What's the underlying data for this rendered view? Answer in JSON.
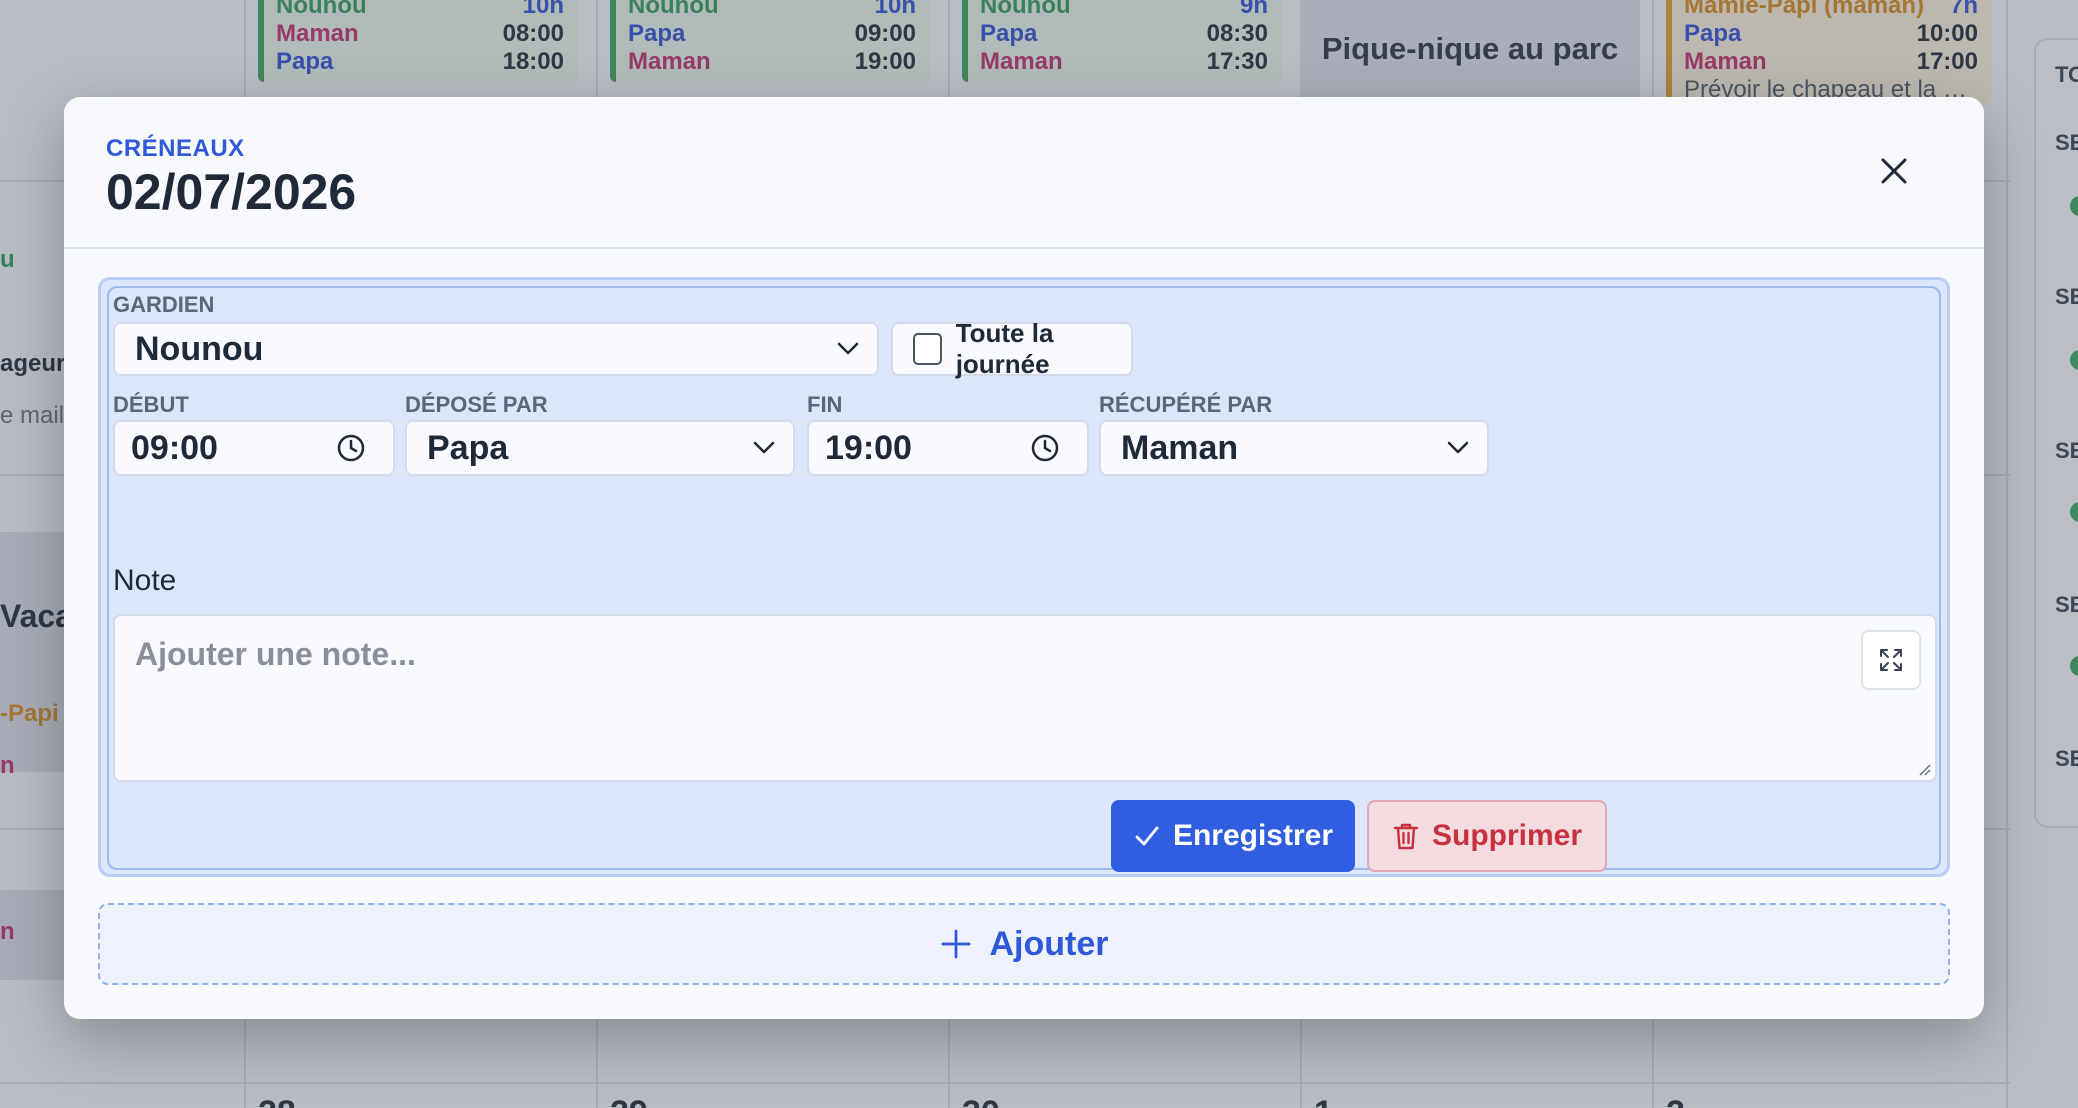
{
  "background": {
    "events": [
      {
        "guardian": "Nounou",
        "duration": "10h",
        "rows": [
          {
            "who": "Maman",
            "time": "08:00"
          },
          {
            "who": "Papa",
            "time": "18:00"
          }
        ]
      },
      {
        "guardian": "Nounou",
        "duration": "10h",
        "rows": [
          {
            "who": "Papa",
            "time": "09:00"
          },
          {
            "who": "Maman",
            "time": "19:00"
          }
        ]
      },
      {
        "guardian": "Nounou",
        "duration": "9h",
        "rows": [
          {
            "who": "Papa",
            "time": "08:30"
          },
          {
            "who": "Maman",
            "time": "17:30"
          }
        ]
      },
      {
        "guardian": "Mamie-Papi (maman)",
        "duration": "7h",
        "rows": [
          {
            "who": "Papa",
            "time": "10:00"
          },
          {
            "who": "Maman",
            "time": "17:00"
          }
        ],
        "note": "Prévoir le chapeau et la cr..."
      }
    ],
    "picnic": "Pique-nique au parc",
    "left_fragments": {
      "u": "u",
      "ageur": "ageur",
      "maillo": "e maillo",
      "vaca": "Vaca",
      "papi": "-Papi (",
      "n": "n"
    },
    "right_panel_header": "TO",
    "right_panel_label": "SE",
    "bottom_numbers": [
      "28",
      "29",
      "30",
      "1",
      "2"
    ]
  },
  "modal": {
    "eyebrow": "CRÉNEAUX",
    "title": "02/07/2026",
    "slot": {
      "guardian_label": "GARDIEN",
      "guardian_value": "Nounou",
      "all_day_label": "Toute la journée",
      "all_day_checked": false,
      "start_label": "DÉBUT",
      "start_value": "09:00",
      "dropped_by_label": "DÉPOSÉ PAR",
      "dropped_by_value": "Papa",
      "end_label": "FIN",
      "end_value": "19:00",
      "picked_by_label": "RÉCUPÉRÉ PAR",
      "picked_by_value": "Maman",
      "note_label": "Note",
      "note_placeholder": "Ajouter une note...",
      "save_label": "Enregistrer",
      "delete_label": "Supprimer"
    },
    "add_label": "Ajouter"
  },
  "colors": {
    "accent": "#2f5ee0",
    "danger": "#c8323f",
    "nounou": "#3aa55d",
    "papa": "#2f4fd1",
    "maman": "#c02d6b",
    "mamie": "#d8891e"
  }
}
